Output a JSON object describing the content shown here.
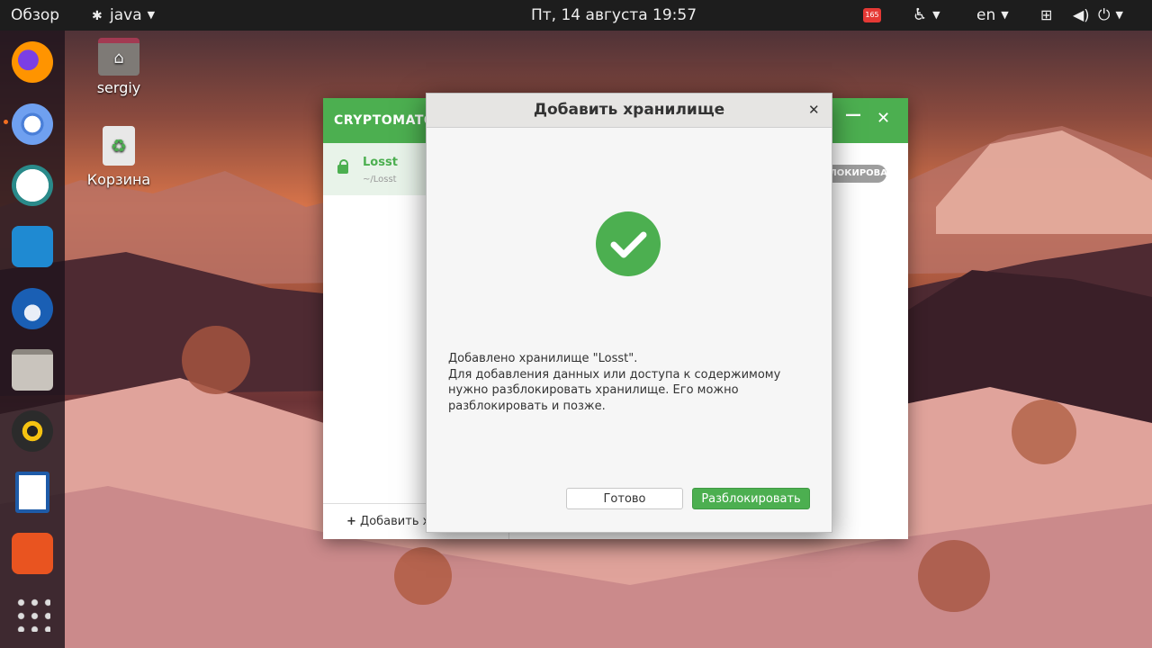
{
  "topbar": {
    "activities": "Обзор",
    "app_name": "java",
    "clock": "Пт, 14 августа  19:57",
    "tray_badge": "165",
    "language": "en",
    "icons": [
      "bug-icon",
      "accessibility-icon",
      "network-icon",
      "volume-icon",
      "power-icon"
    ]
  },
  "dock": {
    "apps": [
      "firefox-icon",
      "chromium-icon",
      "remmina-icon",
      "vscode-icon",
      "thunderbird-icon",
      "files-icon",
      "rhythmbox-icon",
      "libreoffice-writer-icon",
      "software-center-icon",
      "app-grid-icon"
    ]
  },
  "desktop": {
    "home_label": "sergiy",
    "trash_label": "Корзина"
  },
  "cryptomator": {
    "title": "CRYPTOMATOR",
    "vault_name": "Losst",
    "vault_path": "~/Losst",
    "vault_status": "ЗАБЛОКИРОВАНО",
    "add_vault": "Добавить хранилище",
    "add_vault_visible": "Добавить х"
  },
  "dialog": {
    "title": "Добавить хранилище",
    "message_line1": "Добавлено хранилище \"Losst\".",
    "message_line2": "Для добавления данных или доступа к содержимому нужно разблокировать хранилище. Его можно разблокировать и позже.",
    "done_button": "Готово",
    "unlock_button": "Разблокировать"
  },
  "colors": {
    "accent": "#4caf50",
    "topbar": "#1d1d1d"
  }
}
